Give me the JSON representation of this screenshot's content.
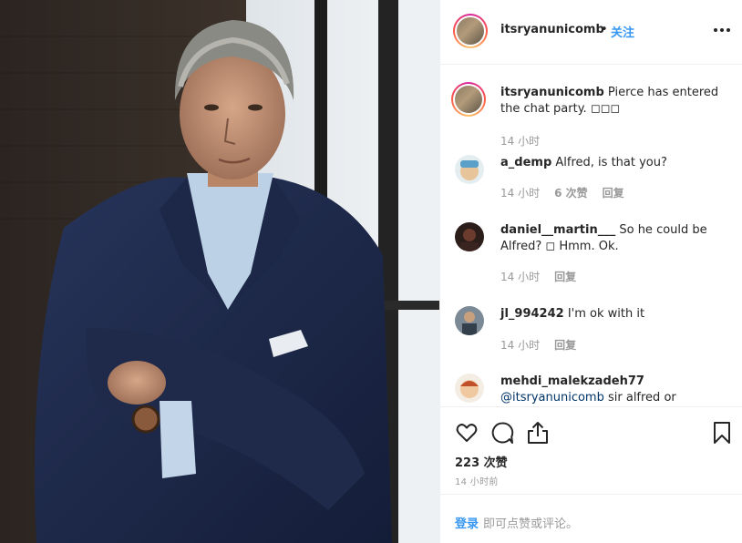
{
  "header": {
    "username": "itsryanunicomb",
    "separator": "•",
    "follow_label": "关注"
  },
  "comments": [
    {
      "username": "itsryanunicomb",
      "text": "Pierce has entered the chat party. ◻◻◻",
      "time": "14 小时"
    },
    {
      "username": "a_demp",
      "text": "Alfred, is that you?",
      "time": "14 小时",
      "likes": "6 次赞",
      "reply": "回复"
    },
    {
      "username": "daniel__martin___",
      "text": "So he could be Alfred? ◻ Hmm. Ok.",
      "time": "14 小时",
      "reply": "回复"
    },
    {
      "username": "jl_994242",
      "text": "I'm ok with it",
      "time": "14 小时",
      "reply": "回复"
    },
    {
      "username": "mehdi_malekzadeh77",
      "mention": "@itsryanunicomb",
      "text": "sir alfred or thomas"
    }
  ],
  "actions": {
    "like_icon": "heart-icon",
    "comment_icon": "comment-bubble-icon",
    "share_icon": "share-icon",
    "save_icon": "bookmark-icon"
  },
  "likes_count": "223 次赞",
  "posted_time": "14 小时前",
  "add_comment": {
    "login_label": "登录",
    "prompt": "即可点赞或评论。"
  },
  "colors": {
    "link": "#3897f0",
    "muted": "#999999",
    "text": "#262626",
    "border": "#efefef"
  }
}
